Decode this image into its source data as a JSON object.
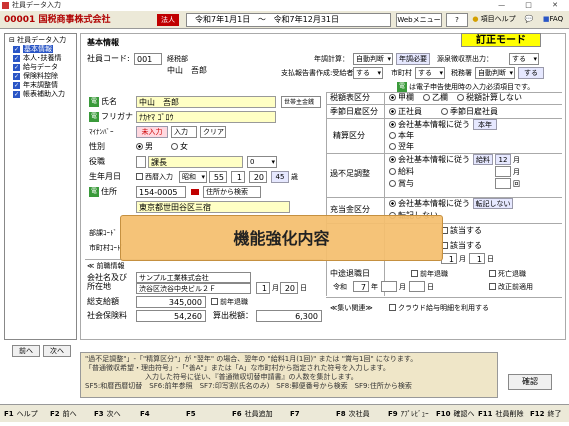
{
  "window": {
    "title": "社員データ入力",
    "controls": "—  □  ✕"
  },
  "toolbar": {
    "company": "00001 国税商事株式会社",
    "corp_type": "法人",
    "period_from": "令和7年1月1日",
    "period_sep": "～",
    "period_to": "令和7年12月31日",
    "web_menu": "Webメニュー",
    "help": "ヘルプ",
    "item_help": "項目ヘルプ",
    "faq": "FAQ"
  },
  "sidebar": {
    "root": "社員データ入力",
    "items": [
      {
        "label": "基本情報",
        "selected": true
      },
      {
        "label": "本人･扶養情",
        "selected": false
      },
      {
        "label": "給与データ",
        "selected": false
      },
      {
        "label": "保険料控除",
        "selected": false
      },
      {
        "label": "年末調整情",
        "selected": false
      },
      {
        "label": "帳表補助入力",
        "selected": false
      }
    ],
    "prev": "前へ",
    "next": "次へ"
  },
  "main": {
    "section": "基本情報",
    "mode_badge": "訂正モード",
    "employee_code_label": "社員コード:",
    "employee_code": "001",
    "employee_code_status": "経税部",
    "employee_name_display": "中山　吾郎",
    "nenkei_label": "年調計算：",
    "nenkei_value": "自動判断",
    "nenkei_need": "年調必要",
    "gensen_label": "源泉徴収票出力：",
    "gensen_value": "する",
    "shiharai_label": "支払報告書作成:受給者",
    "shiharai_value": "する",
    "city_label": "市町村",
    "city_value": "する",
    "zeimusho_label": "税務署",
    "zeimusho_value": "自動判断",
    "zeimusho_value2": "する",
    "note_green": "は電子申告使用時の入力必須項目です。",
    "name_label": "氏名",
    "name_value": "中山　吾郎",
    "household_label": "世帯主金銭",
    "furigana_label": "フリガナ",
    "furigana_value": "ﾅｶﾔﾏ ｺﾞﾛｳ",
    "mynumber_label": "ﾏｲﾅﾝﾊﾞｰ",
    "mynumber_status": "未入力",
    "mynumber_input": "入力",
    "mynumber_clear": "クリア",
    "gender_label": "性別",
    "gender_male": "男",
    "gender_female": "女",
    "position_label": "役職",
    "position_value": "課長",
    "position_code": "0",
    "birth_label": "生年月日",
    "birth_western": "西暦入力",
    "birth_era": "昭和",
    "birth_year": "55",
    "birth_month": "1",
    "birth_day": "20",
    "birth_age": "45",
    "birth_age_unit": "歳",
    "address_label": "住所",
    "zip": "154-0005",
    "address_search": "住所から検索",
    "address_value": "東京都世田谷区三宿",
    "dept_label": "部課ｺｰﾄﾞ",
    "city_code_label": "市町村ｺｰﾄﾞ",
    "prev_job_label": "≪ 前職情報",
    "prev_company_label": "会社名及び",
    "prev_location_label": "所在地",
    "prev_company_name": "サンプル工業株式会社",
    "prev_company_addr": "渋谷区渋谷中央ビル２Ｆ",
    "prev_retire_month": "1",
    "prev_retire_month_unit": "月",
    "prev_retire_day": "20",
    "prev_retire_day_unit": "日",
    "total_pay_label": "総支給額",
    "total_pay": "345,000",
    "prev_nencho_check": "前年退職",
    "social_ins_label": "社会保険料",
    "social_ins": "54,260",
    "tax_label": "算出税額：",
    "tax_value": "6,300",
    "tax_class_label": "税額表区分",
    "tax_kou": "甲欄",
    "tax_otsu": "乙欄",
    "tax_none": "税額計算しない",
    "season_label": "季節日雇区分",
    "season_regular": "正社員",
    "season_daily": "季節日雇社員",
    "calc_label": "精算区分",
    "calc_follow": "会社基本情報に従う",
    "calc_follow_val": "本年",
    "calc_this": "本年",
    "calc_next": "翌年",
    "shortfall_label": "過不足調整",
    "shortfall_follow": "会社基本情報に従う",
    "shortfall_salary": "給料",
    "shortfall_month": "12",
    "shortfall_month_unit": "月",
    "shortfall_pay": "給料",
    "shortfall_unit2": "月",
    "shortfall_bonus": "賞与",
    "shortfall_unit3": "回",
    "allocation_label": "充当金区分",
    "allocation_follow": "会社基本情報に従う",
    "allocation_follow_val": "転記しない",
    "allocation_transfer": "転記しない",
    "apply1": "該当する",
    "apply2": "該当する",
    "date_y": "",
    "date_m": "1",
    "date_m_unit": "月",
    "date_d": "1",
    "date_d_unit": "日",
    "retire_date_label": "中途退職日",
    "retire_prev_year": "前年退職",
    "retire_death": "死亡退職",
    "retire_era": "令和",
    "retire_year": "7",
    "retire_year_unit": "年",
    "retire_month_unit": "月",
    "retire_day_unit": "日",
    "retire_correction": "改正前適用",
    "related_label": "≪集い関連≫",
    "cloud_check": "クラウド給与明細を利用する",
    "overlay_text": "機能強化内容"
  },
  "notes": {
    "line1": "\"過不足調整\"」-「\"精算区分\"」が \"翌年\" の場合、翌年の \"給料1月(1回)\" または \"賞与1回\" になります。",
    "line2": "「普通徴収希望・理由符号」-「\"善A\"」または「A」な市町村から指定された符号を入力します。",
    "line3": "入力した符号に従い、『普通徴収切替申請書』の人数を集計します。",
    "line4": "SF5:和暦西暦切替　SF6:前年参照　SF7:印写割(氏名のみ)　SF8:郵便番号から検索　SF9:住所から検索"
  },
  "confirm_button": "確認",
  "fkeys": [
    {
      "key": "F1",
      "label": "ヘルプ"
    },
    {
      "key": "F2",
      "label": "前へ"
    },
    {
      "key": "F3",
      "label": "次へ"
    },
    {
      "key": "F4",
      "label": ""
    },
    {
      "key": "F5",
      "label": ""
    },
    {
      "key": "F6",
      "label": "社員追加"
    },
    {
      "key": "F7",
      "label": ""
    },
    {
      "key": "F8",
      "label": "次社員"
    },
    {
      "key": "F9",
      "label": "ｱﾌﾟﾚﾋﾞｭｰ"
    },
    {
      "key": "F10",
      "label": "確認へ"
    },
    {
      "key": "F11",
      "label": "社員削除"
    },
    {
      "key": "F12",
      "label": "終了"
    }
  ]
}
